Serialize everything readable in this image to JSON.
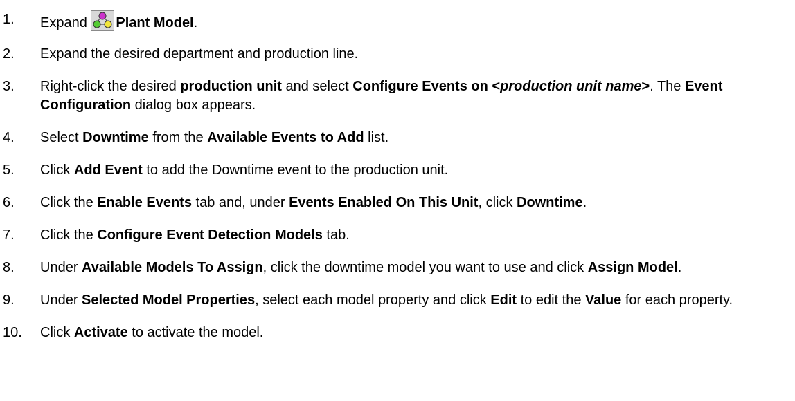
{
  "steps": [
    {
      "number": "1.",
      "parts": [
        "Expand ",
        "Plant Model",
        "."
      ],
      "icon": "plant-model-icon"
    },
    {
      "number": "2.",
      "text": "Expand the desired department and production line."
    },
    {
      "number": "3.",
      "parts": [
        "Right-click the desired ",
        "production unit",
        " and select ",
        "Configure Events on ",
        "<",
        "production unit name",
        ">",
        ". The ",
        "Event Configuration",
        " dialog box appears."
      ]
    },
    {
      "number": "4.",
      "parts": [
        "Select ",
        "Downtime",
        " from the ",
        "Available Events to Add",
        " list."
      ]
    },
    {
      "number": "5.",
      "parts": [
        "Click ",
        "Add Event",
        " to add the Downtime event to the production unit."
      ]
    },
    {
      "number": "6.",
      "parts": [
        "Click the ",
        "Enable Events",
        " tab and, under ",
        "Events Enabled On This Unit",
        ", click ",
        "Downtime",
        "."
      ]
    },
    {
      "number": "7.",
      "parts": [
        "Click the ",
        "Configure Event Detection Models",
        " tab."
      ]
    },
    {
      "number": "8.",
      "parts": [
        "Under ",
        "Available Models To Assign",
        ", click the downtime model you want to use and click ",
        "Assign Model",
        "."
      ]
    },
    {
      "number": "9.",
      "parts": [
        "Under ",
        "Selected Model Properties",
        ", select each model property and click ",
        "Edit",
        " to edit the ",
        "Value",
        " for each property."
      ]
    },
    {
      "number": "10.",
      "parts": [
        "Click ",
        "Activate",
        " to activate the model."
      ]
    }
  ]
}
